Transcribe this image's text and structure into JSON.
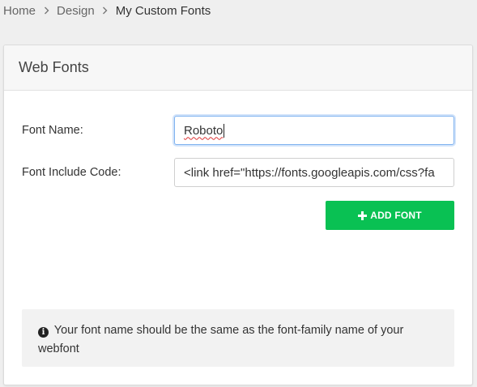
{
  "breadcrumb": {
    "items": [
      "Home",
      "Design"
    ],
    "current": "My Custom Fonts",
    "separator_icon": "chevron-right-icon"
  },
  "panel": {
    "title": "Web Fonts"
  },
  "form": {
    "font_name_label": "Font Name:",
    "font_name_value": "Roboto",
    "font_include_label": "Font Include Code:",
    "font_include_value": "<link href=\"https://fonts.googleapis.com/css?fa"
  },
  "add_button": {
    "label": "ADD FONT",
    "icon": "plus-icon",
    "color": "#09c153"
  },
  "info": {
    "icon": "info-circle-icon",
    "text": "Your font name should be the same as the font-family name of your webfont"
  },
  "colors": {
    "focus_border": "#80b3f0",
    "background": "#efefef"
  }
}
